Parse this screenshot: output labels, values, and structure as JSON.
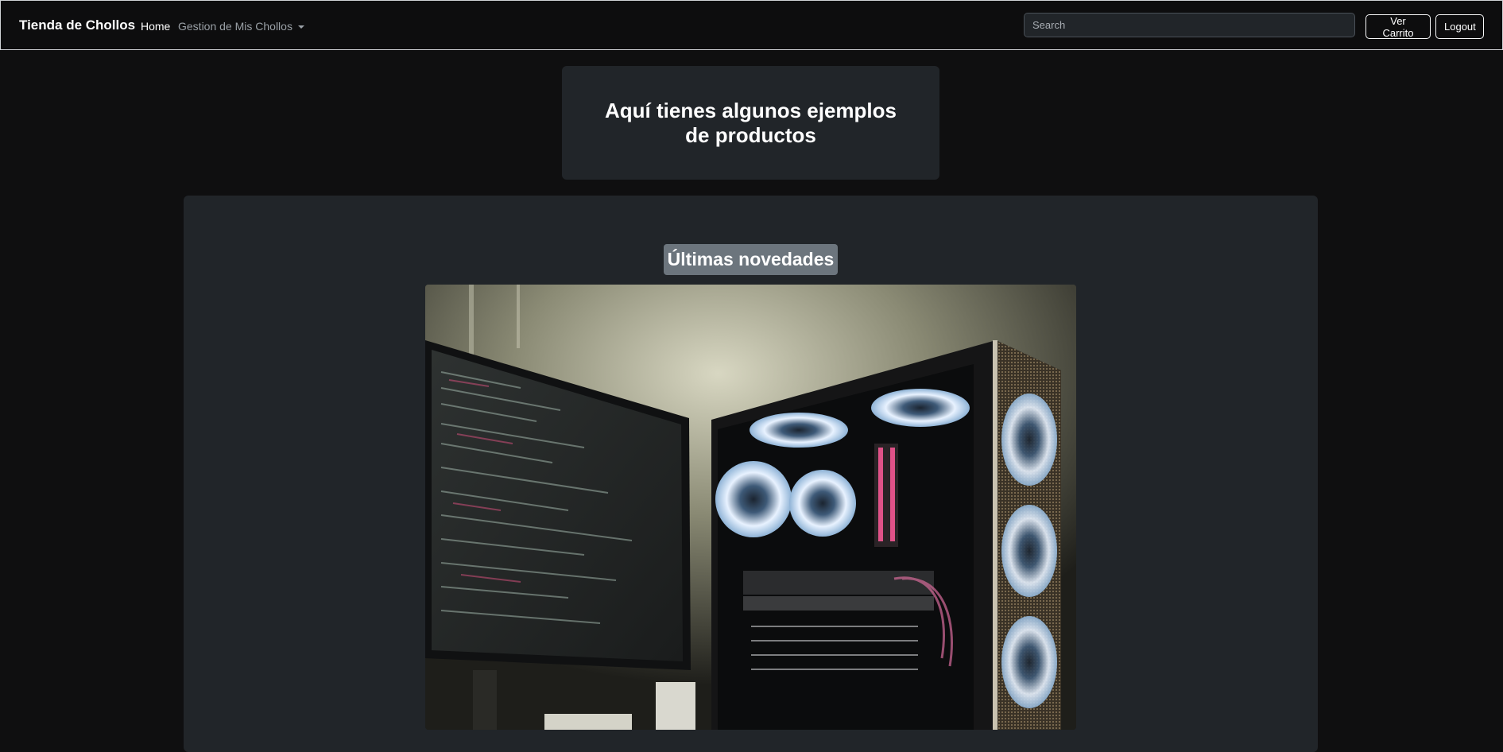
{
  "navbar": {
    "brand": "Tienda de Chollos",
    "home_label": "Home",
    "dropdown_label": "Gestion de Mis Chollos",
    "search_placeholder": "Search",
    "cart_button": "Ver Carrito",
    "logout_button": "Logout"
  },
  "hero": {
    "title": "Aquí tienes algunos ejemplos de productos"
  },
  "section": {
    "title": "Últimas novedades"
  }
}
